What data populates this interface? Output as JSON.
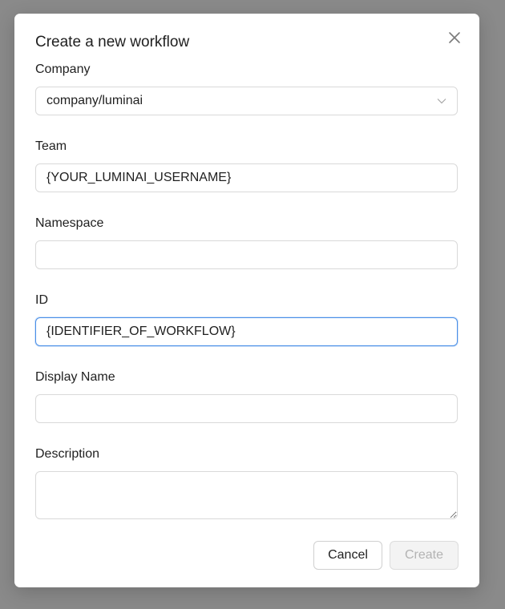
{
  "dialog": {
    "title": "Create a new workflow",
    "close_icon": "close-icon"
  },
  "form": {
    "company": {
      "label": "Company",
      "value": "company/luminai",
      "icon": "chevron-down-icon"
    },
    "team": {
      "label": "Team",
      "value": "{YOUR_LUMINAI_USERNAME}",
      "placeholder": ""
    },
    "namespace": {
      "label": "Namespace",
      "value": "",
      "placeholder": ""
    },
    "id": {
      "label": "ID",
      "value": "{IDENTIFIER_OF_WORKFLOW}",
      "placeholder": "",
      "focused": true
    },
    "display_name": {
      "label": "Display Name",
      "value": "",
      "placeholder": ""
    },
    "description": {
      "label": "Description",
      "value": "",
      "placeholder": ""
    }
  },
  "actions": {
    "cancel_label": "Cancel",
    "create_label": "Create",
    "create_disabled": true
  },
  "colors": {
    "backdrop": "#8a8a8a",
    "focus_border": "#4a8fe7",
    "border": "#d9d9d9",
    "disabled_text": "#b3b3b3"
  }
}
